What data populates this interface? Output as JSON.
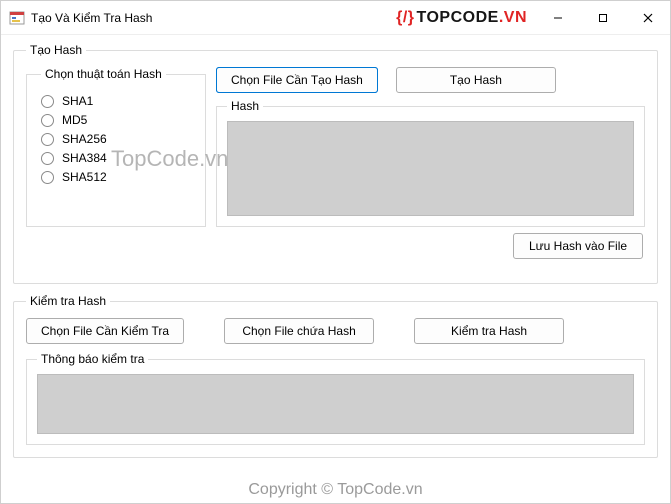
{
  "titlebar": {
    "title": "Tạo Và Kiểm Tra Hash",
    "brand_symbol": "{/}",
    "brand_text": "TOPCODE",
    "brand_suffix": ".VN"
  },
  "create_group": {
    "legend": "Tạo Hash",
    "algo_legend": "Chọn thuật toán Hash",
    "algorithms": [
      "SHA1",
      "MD5",
      "SHA256",
      "SHA384",
      "SHA512"
    ],
    "choose_file_btn": "Chọn File Cần Tạo Hash",
    "create_btn": "Tạo Hash",
    "hash_legend": "Hash",
    "hash_value": "",
    "save_btn": "Lưu Hash vào File"
  },
  "check_group": {
    "legend": "Kiểm tra Hash",
    "choose_file_btn": "Chọn File Cần Kiểm Tra",
    "choose_hash_file_btn": "Chọn File chứa Hash",
    "check_btn": "Kiểm tra Hash",
    "msg_legend": "Thông báo kiểm tra",
    "msg_value": ""
  },
  "watermarks": {
    "center": "TopCode.vn",
    "bottom": "Copyright © TopCode.vn"
  }
}
